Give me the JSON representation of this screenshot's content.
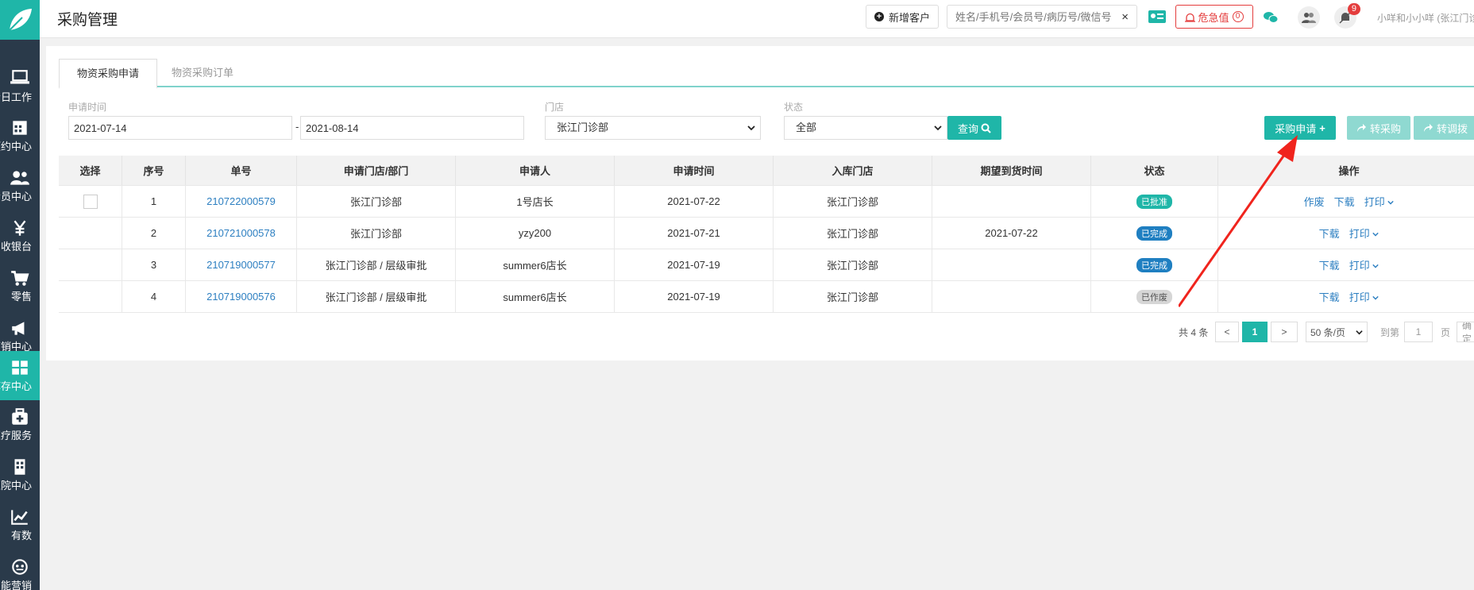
{
  "header": {
    "title": "采购管理",
    "new_customer": "新增客户",
    "search_placeholder": "姓名/手机号/会员号/病历号/微信号",
    "search_clear": "×",
    "danger_label": "危急值",
    "danger_count": "0",
    "notify_count": "9",
    "user": "小咩和小小咩 (张江门诊"
  },
  "sidebar": {
    "items": [
      {
        "label": "今日工作",
        "icon": "laptop-icon"
      },
      {
        "label": "预约中心",
        "icon": "calendar-icon"
      },
      {
        "label": "会员中心",
        "icon": "users-icon"
      },
      {
        "label": "收银台",
        "icon": "yen-icon"
      },
      {
        "label": "零售",
        "icon": "cart-icon"
      },
      {
        "label": "营销中心",
        "icon": "megaphone-icon"
      },
      {
        "label": "库存中心",
        "icon": "grid-icon"
      },
      {
        "label": "医疗服务",
        "icon": "medkit-icon"
      },
      {
        "label": "医院中心",
        "icon": "building-icon"
      },
      {
        "label": "有数",
        "icon": "chart-icon"
      },
      {
        "label": "智能营销",
        "icon": "robot-icon"
      }
    ]
  },
  "tabs": [
    "物资采购申请",
    "物资采购订单"
  ],
  "filters": {
    "date_label": "申请时间",
    "date_from": "2021-07-14",
    "date_sep": "-",
    "date_to": "2021-08-14",
    "store_label": "门店",
    "store_value": "张江门诊部",
    "status_label": "状态",
    "status_value": "全部",
    "query_button": "查询"
  },
  "actions": {
    "apply": "采购申请",
    "to_purchase": "转采购",
    "to_transfer": "转调拨"
  },
  "table": {
    "columns": [
      "选择",
      "序号",
      "单号",
      "申请门店/部门",
      "申请人",
      "申请时间",
      "入库门店",
      "期望到货时间",
      "状态",
      "操作"
    ],
    "rows": [
      {
        "idx": "1",
        "no": "210722000579",
        "dept": "张江门诊部",
        "applicant": "1号店长",
        "time": "2021-07-22",
        "store": "张江门诊部",
        "expect": "",
        "status": "已批准",
        "ops": [
          "作废",
          "下载",
          "打印"
        ]
      },
      {
        "idx": "2",
        "no": "210721000578",
        "dept": "张江门诊部",
        "applicant": "yzy200",
        "time": "2021-07-21",
        "store": "张江门诊部",
        "expect": "2021-07-22",
        "status": "已完成",
        "ops": [
          "下载",
          "打印"
        ]
      },
      {
        "idx": "3",
        "no": "210719000577",
        "dept": "张江门诊部 / 层级审批",
        "applicant": "summer6店长",
        "time": "2021-07-19",
        "store": "张江门诊部",
        "expect": "",
        "status": "已完成",
        "ops": [
          "下载",
          "打印"
        ]
      },
      {
        "idx": "4",
        "no": "210719000576",
        "dept": "张江门诊部 / 层级审批",
        "applicant": "summer6店长",
        "time": "2021-07-19",
        "store": "张江门诊部",
        "expect": "",
        "status": "已作废",
        "ops": [
          "下载",
          "打印"
        ]
      }
    ]
  },
  "pager": {
    "total": "共 4 条",
    "prev": "<",
    "page": "1",
    "next": ">",
    "size": "50 条/页",
    "goto": "到第",
    "goto_value": "1",
    "unit": "页",
    "confirm": "确定"
  },
  "colors": {
    "accent": "#1fb6a8",
    "link": "#2d7fc1",
    "danger": "#e43d3d",
    "sidebar": "#2a3a4a"
  }
}
